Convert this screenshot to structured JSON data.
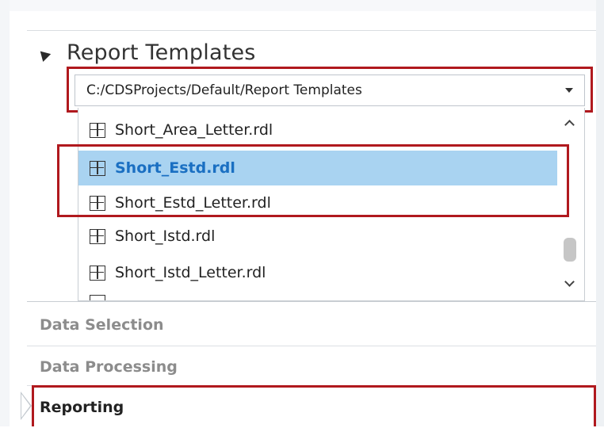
{
  "section": {
    "title": "Report Templates"
  },
  "path_combo": {
    "value": "C:/CDSProjects/Default/Report Templates"
  },
  "template_list": {
    "items": [
      {
        "label": "Short_Area_Letter.rdl",
        "selected": false
      },
      {
        "label": "Short_Estd.rdl",
        "selected": true
      },
      {
        "label": "Short_Estd_Letter.rdl",
        "selected": false
      },
      {
        "label": "Short_Istd.rdl",
        "selected": false
      },
      {
        "label": "Short_Istd_Letter.rdl",
        "selected": false
      }
    ]
  },
  "nav": {
    "data_selection": "Data Selection",
    "data_processing": "Data Processing",
    "reporting": "Reporting"
  },
  "colors": {
    "highlight_outline": "#b0191e",
    "selected_row_bg": "#a9d3f1",
    "selected_row_text": "#1a6fc2"
  },
  "icons": {
    "section_toggle": "collapse-triangle-icon",
    "template_file": "report-template-icon",
    "combo": "dropdown-arrow-icon"
  }
}
